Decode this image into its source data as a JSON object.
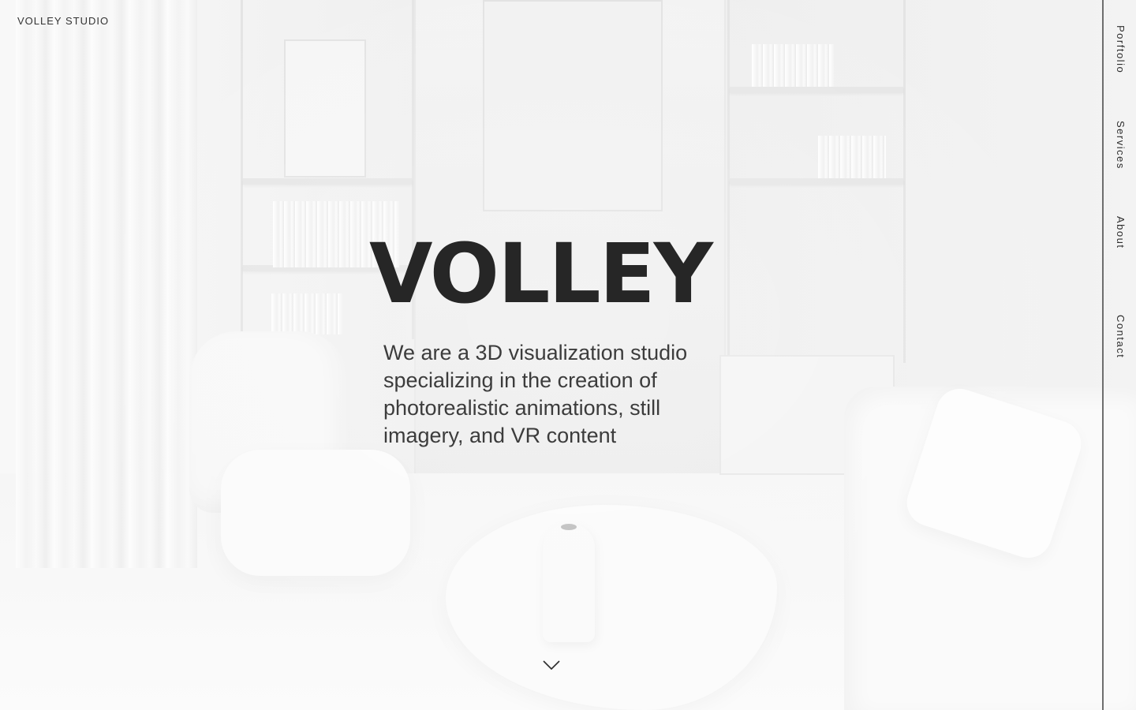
{
  "brand": {
    "logo_text": "VOLLEY STUDIO"
  },
  "hero": {
    "title": "VOLLEY",
    "description": "We are a 3D visualization studio specializing in the creation of photorealistic animations, still imagery, and VR content",
    "background": "white-clay-living-room-render"
  },
  "side_nav": {
    "items": [
      {
        "label": "Porftolio"
      },
      {
        "label": "Services"
      },
      {
        "label": "About"
      },
      {
        "label": "Contact"
      }
    ]
  },
  "scroll_indicator": {
    "icon": "chevron-down-icon"
  },
  "colors": {
    "text": "#262626",
    "background": "#f4f4f4",
    "nav_rule": "#6e6e6e"
  }
}
